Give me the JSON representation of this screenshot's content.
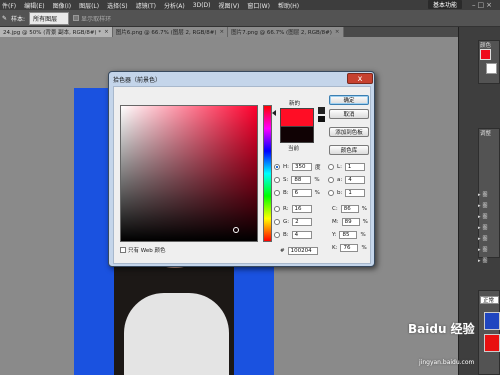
{
  "menubar": {
    "items": [
      "件(F)",
      "编辑(E)",
      "图像(I)",
      "图层(L)",
      "选择(S)",
      "滤镜(T)",
      "分析(A)",
      "3D(D)",
      "视图(V)",
      "窗口(W)",
      "帮助(H)"
    ],
    "workspace_label": "基本功能"
  },
  "optbar": {
    "sample_label": "样本:",
    "sample_value": "所有图层",
    "show_ring_label": "显示取样环"
  },
  "tabs": [
    {
      "label": "24.jpg @ 50% (背景 副本, RGB/8#) *"
    },
    {
      "label": "图片6.png @ 66.7% (图层 2, RGB/8#)"
    },
    {
      "label": "图片7.png @ 66.7% (图层 2, RGB/8#)"
    }
  ],
  "dialog": {
    "title": "拾色器（前景色）",
    "close_glyph": "x",
    "new_label": "新的",
    "current_label": "当前",
    "buttons": {
      "ok": "确定",
      "cancel": "取消",
      "add_swatch": "添加到色板",
      "libraries": "颜色库"
    },
    "hsb": {
      "h_label": "H:",
      "h_value": "350",
      "h_unit": "度",
      "s_label": "S:",
      "s_value": "88",
      "s_unit": "%",
      "b_label": "B:",
      "b_value": "6",
      "b_unit": "%"
    },
    "lab": {
      "l_label": "L:",
      "l_value": "1",
      "a_label": "a:",
      "a_value": "4",
      "b_label": "b:",
      "b_value": "1"
    },
    "rgb": {
      "r_label": "R:",
      "r_value": "16",
      "g_label": "G:",
      "g_value": "2",
      "b_label": "B:",
      "b_value": "4"
    },
    "cmyk": {
      "c_label": "C:",
      "c_value": "86",
      "c_unit": "%",
      "m_label": "M:",
      "m_value": "89",
      "m_unit": "%",
      "y_label": "Y:",
      "y_value": "85",
      "y_unit": "%",
      "k_label": "K:",
      "k_value": "76",
      "k_unit": "%"
    },
    "hex_label": "#",
    "hex_value": "100204",
    "web_only_label": "只有 Web 颜色"
  },
  "panels": {
    "tab_color": "颜色",
    "tab_adjust": "调整",
    "layer_mode": "正常",
    "layers": [
      "图",
      "图",
      "图",
      "图",
      "图",
      "图",
      "图"
    ]
  },
  "colors": {
    "new_color": "#ff0d25",
    "current_color": "#100204",
    "photo_bg": "#1a52e0"
  },
  "watermark": {
    "brand": "Baidu 经验",
    "url": "jingyan.baidu.com"
  }
}
